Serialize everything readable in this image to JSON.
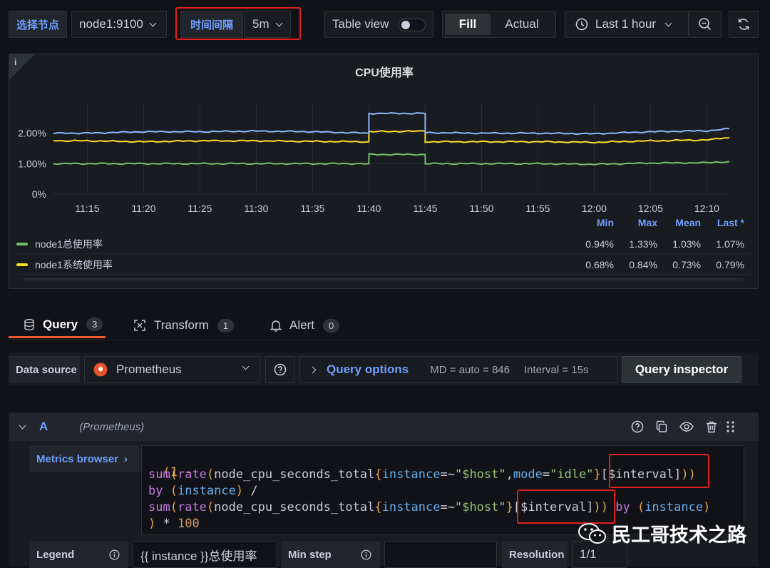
{
  "toolbar": {
    "node_label": "选择节点",
    "node_value": "node1:9100",
    "interval_label": "时间间隔",
    "interval_value": "5m",
    "table_view": "Table view",
    "fill": "Fill",
    "actual": "Actual",
    "time_range": "Last 1 hour"
  },
  "panel": {
    "info_icon": "i",
    "title": "CPU使用率"
  },
  "chart_data": {
    "type": "line",
    "title": "CPU使用率",
    "y_ticks": [
      "2.00%",
      "1.00%",
      "0%"
    ],
    "ylim": [
      0,
      3
    ],
    "x_ticks": [
      "11:15",
      "11:20",
      "11:25",
      "11:30",
      "11:35",
      "11:40",
      "11:45",
      "11:50",
      "11:55",
      "12:00",
      "12:05",
      "12:10"
    ],
    "x": [
      "11:12",
      "11:15",
      "11:20",
      "11:25",
      "11:30",
      "11:35",
      "11:40",
      "11:40",
      "11:45",
      "11:45",
      "11:50",
      "11:55",
      "12:00",
      "12:05",
      "12:10",
      "12:12"
    ],
    "series": [
      {
        "name": "node1总使用率",
        "color": "#73bf69",
        "values": [
          1.0,
          1.0,
          1.0,
          1.0,
          1.0,
          1.0,
          1.0,
          1.3,
          1.3,
          1.0,
          1.0,
          1.0,
          0.98,
          1.02,
          1.03,
          1.07
        ]
      },
      {
        "name": "node1系统使用率",
        "color": "#fade2a",
        "values": [
          1.75,
          1.75,
          1.72,
          1.75,
          1.75,
          1.73,
          1.72,
          2.05,
          2.07,
          1.72,
          1.72,
          1.72,
          1.7,
          1.75,
          1.78,
          1.85
        ]
      },
      {
        "name": "",
        "color": "#8ab8ff",
        "values": [
          2.0,
          2.0,
          2.05,
          2.05,
          2.07,
          2.05,
          2.0,
          2.65,
          2.65,
          2.02,
          2.0,
          2.0,
          1.98,
          2.05,
          2.08,
          2.15
        ]
      }
    ],
    "legend_columns": [
      "Min",
      "Max",
      "Mean",
      "Last *"
    ],
    "legend": [
      {
        "name": "node1总使用率",
        "color": "#73bf69",
        "min": "0.94%",
        "max": "1.33%",
        "mean": "1.03%",
        "last": "1.07%"
      },
      {
        "name": "node1系统使用率",
        "color": "#fade2a",
        "min": "0.68%",
        "max": "0.84%",
        "mean": "0.73%",
        "last": "0.79%"
      }
    ]
  },
  "tabs": {
    "query": "Query",
    "query_count": "3",
    "transform": "Transform",
    "transform_count": "1",
    "alert": "Alert",
    "alert_count": "0"
  },
  "datasource": {
    "label": "Data source",
    "value": "Prometheus",
    "query_options": "Query options",
    "md": "MD = auto = 846",
    "interval": "Interval = 15s",
    "inspector": "Query inspector"
  },
  "query_a": {
    "ref": "A",
    "ds": "(Prometheus)",
    "metrics_browser": "Metrics browser",
    "code": {
      "l1": "(1 -",
      "l2_sum": "sum",
      "l2_rate": "rate",
      "l2_metric": "node_cpu_seconds_total",
      "l2_inst": "instance",
      "l2_host": "\"$host\"",
      "l2_mode": "mode",
      "l2_idle": "\"idle\"",
      "l2_interval": "[$interval]",
      "l3_by": "by",
      "l3_inst": "instance",
      "l4_sum": "sum",
      "l4_rate": "rate",
      "l4_metric": "node_cpu_seconds_total",
      "l4_inst": "instance",
      "l4_host": "\"$host\"",
      "l4_interval": "[$interval]",
      "l4_by": "by",
      "l4_inst2": "instance",
      "l5_num": "100"
    }
  },
  "options_row": {
    "legend_label": "Legend",
    "legend_value": "{{ instance }}总使用率",
    "min_step_label": "Min step",
    "resolution_label": "Resolution",
    "resolution_value": "1/1"
  },
  "watermark": "民工哥技术之路"
}
